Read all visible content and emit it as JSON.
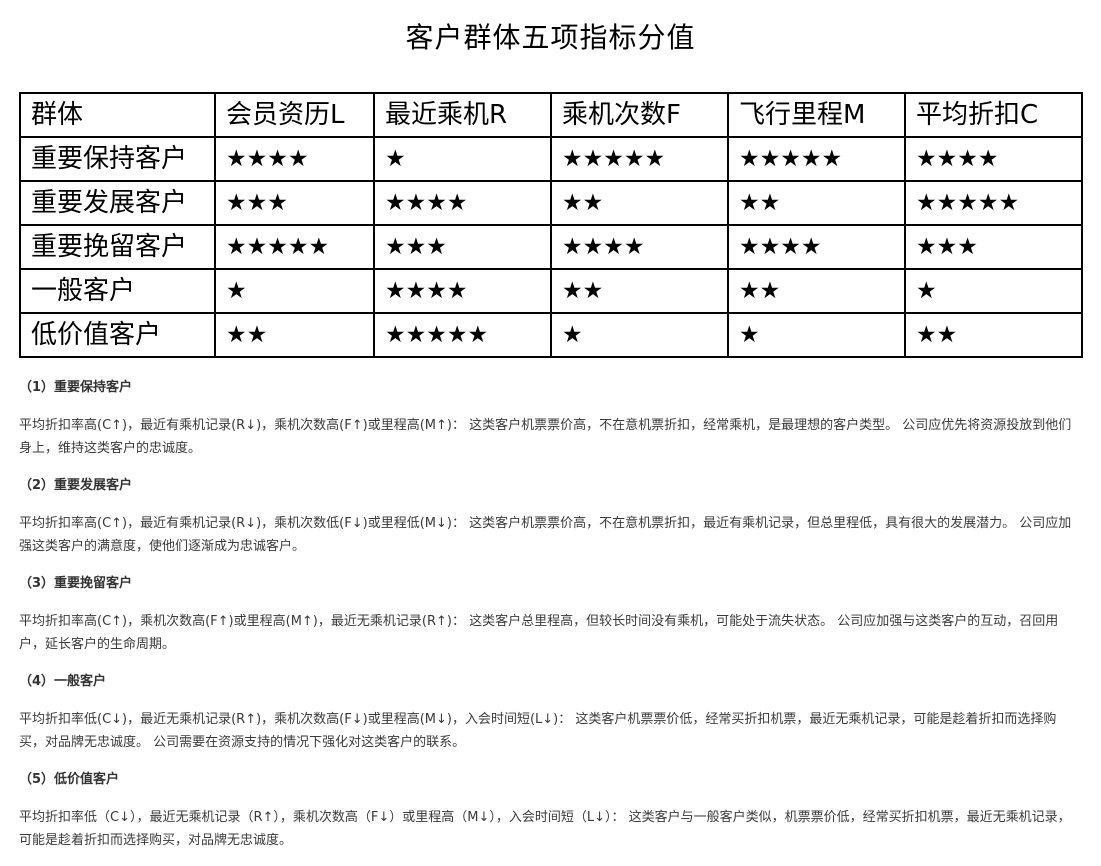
{
  "page": {
    "title": "客户群体五项指标分值"
  },
  "table": {
    "headers": [
      "群体",
      "会员资历L",
      "最近乘机R",
      "乘机次数F",
      "飞行里程M",
      "平均折扣C"
    ],
    "rows": [
      [
        "重要保持客户",
        "★★★★",
        "★",
        "★★★★★",
        "★★★★★",
        "★★★★"
      ],
      [
        "重要发展客户",
        "★★★",
        "★★★★",
        "★★",
        "★★",
        "★★★★★"
      ],
      [
        "重要挽留客户",
        "★★★★★",
        "★★★",
        "★★★★",
        "★★★★",
        "★★★"
      ],
      [
        "一般客户",
        "★",
        "★★★★",
        "★★",
        "★★",
        "★"
      ],
      [
        "低价值客户",
        "★★",
        "★★★★★",
        "★",
        "★",
        "★★"
      ]
    ]
  },
  "sections": [
    {
      "title": "（1）重要保持客户",
      "body": "平均折扣率高(C↑)，最近有乘机记录(R↓)，乘机次数高(F↑)或里程高(M↑)： 这类客户机票票价高，不在意机票折扣，经常乘机，是最理想的客户类型。 公司应优先将资源投放到他们身上，维持这类客户的忠诚度。"
    },
    {
      "title": "（2）重要发展客户",
      "body": "平均折扣率高(C↑)，最近有乘机记录(R↓)，乘机次数低(F↓)或里程低(M↓)： 这类客户机票票价高，不在意机票折扣，最近有乘机记录，但总里程低，具有很大的发展潜力。 公司应加强这类客户的满意度，使他们逐渐成为忠诚客户。"
    },
    {
      "title": "（3）重要挽留客户",
      "body": "平均折扣率高(C↑)，乘机次数高(F↑)或里程高(M↑)，最近无乘机记录(R↑)： 这类客户总里程高，但较长时间没有乘机，可能处于流失状态。 公司应加强与这类客户的互动，召回用户，延长客户的生命周期。"
    },
    {
      "title": "（4）一般客户",
      "body": "平均折扣率低(C↓)，最近无乘机记录(R↑)，乘机次数高(F↓)或里程高(M↓)，入会时间短(L↓)： 这类客户机票票价低，经常买折扣机票，最近无乘机记录，可能是趁着折扣而选择购买，对品牌无忠诚度。 公司需要在资源支持的情况下强化对这类客户的联系。"
    },
    {
      "title": "（5）低价值客户",
      "body": "平均折扣率低（C↓），最近无乘机记录（R↑），乘机次数高（F↓）或里程高（M↓），入会时间短（L↓）： 这类客户与一般客户类似，机票票价低，经常买折扣机票，最近无乘机记录，可能是趁着折扣而选择购买，对品牌无忠诚度。"
    }
  ]
}
